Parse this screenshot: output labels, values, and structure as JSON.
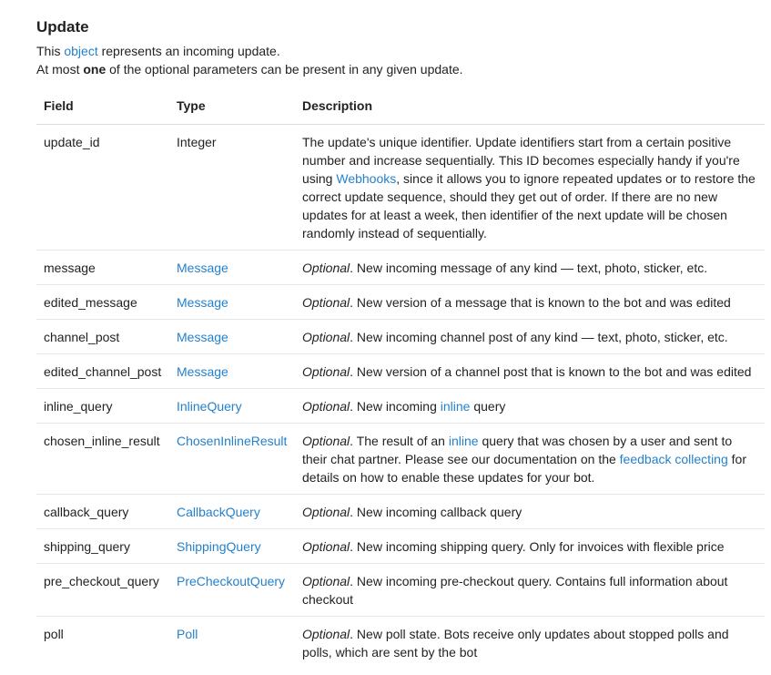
{
  "title": "Update",
  "intro": {
    "line1_before": "This ",
    "line1_link": "object",
    "line1_after": " represents an incoming update.",
    "line2_before": "At most ",
    "line2_bold": "one",
    "line2_after": " of the optional parameters can be present in any given update."
  },
  "table": {
    "headers": [
      "Field",
      "Type",
      "Description"
    ],
    "rows": [
      {
        "field": "update_id",
        "type": "Integer",
        "type_is_link": false,
        "optional": false,
        "desc": [
          {
            "t": "The update's unique identifier. Update identifiers start from a certain positive number and increase sequentially. This ID becomes especially handy if you're using "
          },
          {
            "t": "Webhooks",
            "link": true
          },
          {
            "t": ", since it allows you to ignore repeated updates or to restore the correct update sequence, should they get out of order. If there are no new updates for at least a week, then identifier of the next update will be chosen randomly instead of sequentially."
          }
        ]
      },
      {
        "field": "message",
        "type": "Message",
        "type_is_link": true,
        "optional": true,
        "desc": [
          {
            "t": ". New incoming message of any kind — text, photo, sticker, etc."
          }
        ]
      },
      {
        "field": "edited_message",
        "type": "Message",
        "type_is_link": true,
        "optional": true,
        "desc": [
          {
            "t": ". New version of a message that is known to the bot and was edited"
          }
        ]
      },
      {
        "field": "channel_post",
        "type": "Message",
        "type_is_link": true,
        "optional": true,
        "desc": [
          {
            "t": ". New incoming channel post of any kind — text, photo, sticker, etc."
          }
        ]
      },
      {
        "field": "edited_channel_post",
        "type": "Message",
        "type_is_link": true,
        "optional": true,
        "desc": [
          {
            "t": ". New version of a channel post that is known to the bot and was edited"
          }
        ]
      },
      {
        "field": "inline_query",
        "type": "InlineQuery",
        "type_is_link": true,
        "optional": true,
        "desc": [
          {
            "t": ". New incoming "
          },
          {
            "t": "inline",
            "link": true
          },
          {
            "t": " query"
          }
        ]
      },
      {
        "field": "chosen_inline_result",
        "type": "ChosenInlineResult",
        "type_is_link": true,
        "optional": true,
        "desc": [
          {
            "t": ". The result of an "
          },
          {
            "t": "inline",
            "link": true
          },
          {
            "t": " query that was chosen by a user and sent to their chat partner. Please see our documentation on the "
          },
          {
            "t": "feedback collecting",
            "link": true
          },
          {
            "t": " for details on how to enable these updates for your bot."
          }
        ]
      },
      {
        "field": "callback_query",
        "type": "CallbackQuery",
        "type_is_link": true,
        "optional": true,
        "desc": [
          {
            "t": ". New incoming callback query"
          }
        ]
      },
      {
        "field": "shipping_query",
        "type": "ShippingQuery",
        "type_is_link": true,
        "optional": true,
        "desc": [
          {
            "t": ". New incoming shipping query. Only for invoices with flexible price"
          }
        ]
      },
      {
        "field": "pre_checkout_query",
        "type": "PreCheckoutQuery",
        "type_is_link": true,
        "optional": true,
        "desc": [
          {
            "t": ". New incoming pre-checkout query. Contains full information about checkout"
          }
        ]
      },
      {
        "field": "poll",
        "type": "Poll",
        "type_is_link": true,
        "optional": true,
        "desc": [
          {
            "t": ". New poll state. Bots receive only updates about stopped polls and polls, which are sent by the bot"
          }
        ]
      }
    ],
    "optional_label": "Optional"
  },
  "colors": {
    "link": "#2481cc",
    "text": "#222222",
    "row_border": "#e7e7e7"
  }
}
